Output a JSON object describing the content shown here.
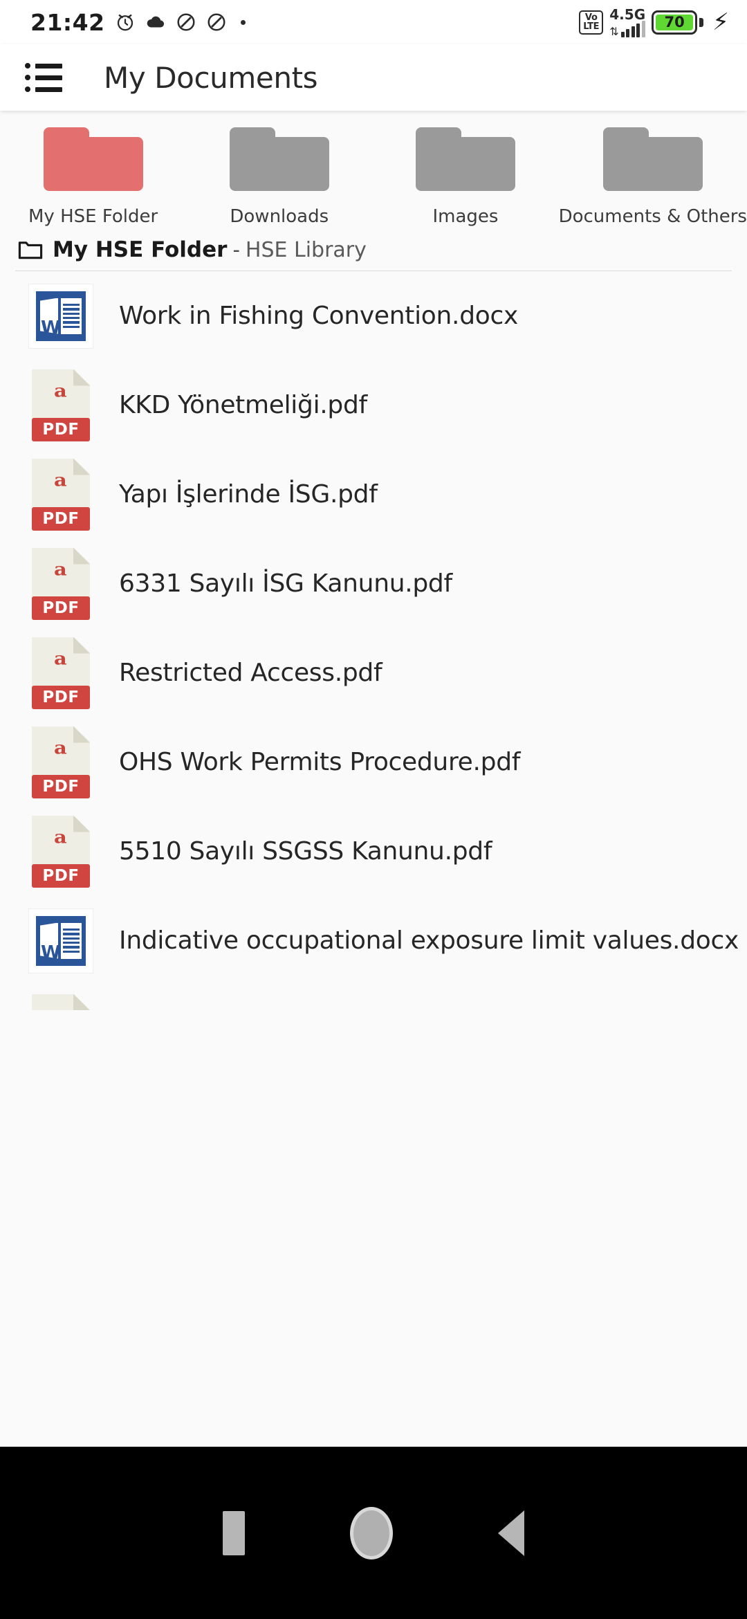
{
  "status_bar": {
    "time": "21:42",
    "icons": [
      "alarm-clock-icon",
      "cloud-icon",
      "do-not-disturb-icon",
      "do-not-disturb-icon",
      "dot-indicator"
    ],
    "volte_top": "Vo",
    "volte_bottom": "LTE",
    "network_generation": "4.5G",
    "data_arrows": "⇅",
    "battery_percent": "70",
    "charging": true
  },
  "app_bar": {
    "menu_icon": "list-menu-icon",
    "title": "My Documents"
  },
  "folders": [
    {
      "label": "My HSE Folder",
      "color": "#e3706e"
    },
    {
      "label": "Downloads",
      "color": "#9a9a9a"
    },
    {
      "label": "Images",
      "color": "#9a9a9a"
    },
    {
      "label": "Documents & Others",
      "color": "#9a9a9a"
    }
  ],
  "breadcrumb": {
    "icon": "folder-outline-icon",
    "current": "My HSE Folder",
    "separator": "-",
    "parent": "HSE Library"
  },
  "files": [
    {
      "name": "Work in Fishing Convention.docx",
      "type": "docx"
    },
    {
      "name": "KKD Yönetmeliği.pdf",
      "type": "pdf"
    },
    {
      "name": "Yapı İşlerinde İSG.pdf",
      "type": "pdf"
    },
    {
      "name": "6331 Sayılı İSG Kanunu.pdf",
      "type": "pdf"
    },
    {
      "name": "Restricted Access.pdf",
      "type": "pdf"
    },
    {
      "name": "OHS Work Permits Procedure.pdf",
      "type": "pdf"
    },
    {
      "name": "5510 Sayılı SSGSS Kanunu.pdf",
      "type": "pdf"
    },
    {
      "name": "Indicative occupational exposure limit values.docx",
      "type": "docx"
    },
    {
      "name": "",
      "type": "pdf"
    }
  ],
  "pdf_badge_label": "PDF",
  "word_letter": "W",
  "nav_bar": {
    "recents": "recents-button",
    "home": "home-button",
    "back": "back-button"
  }
}
